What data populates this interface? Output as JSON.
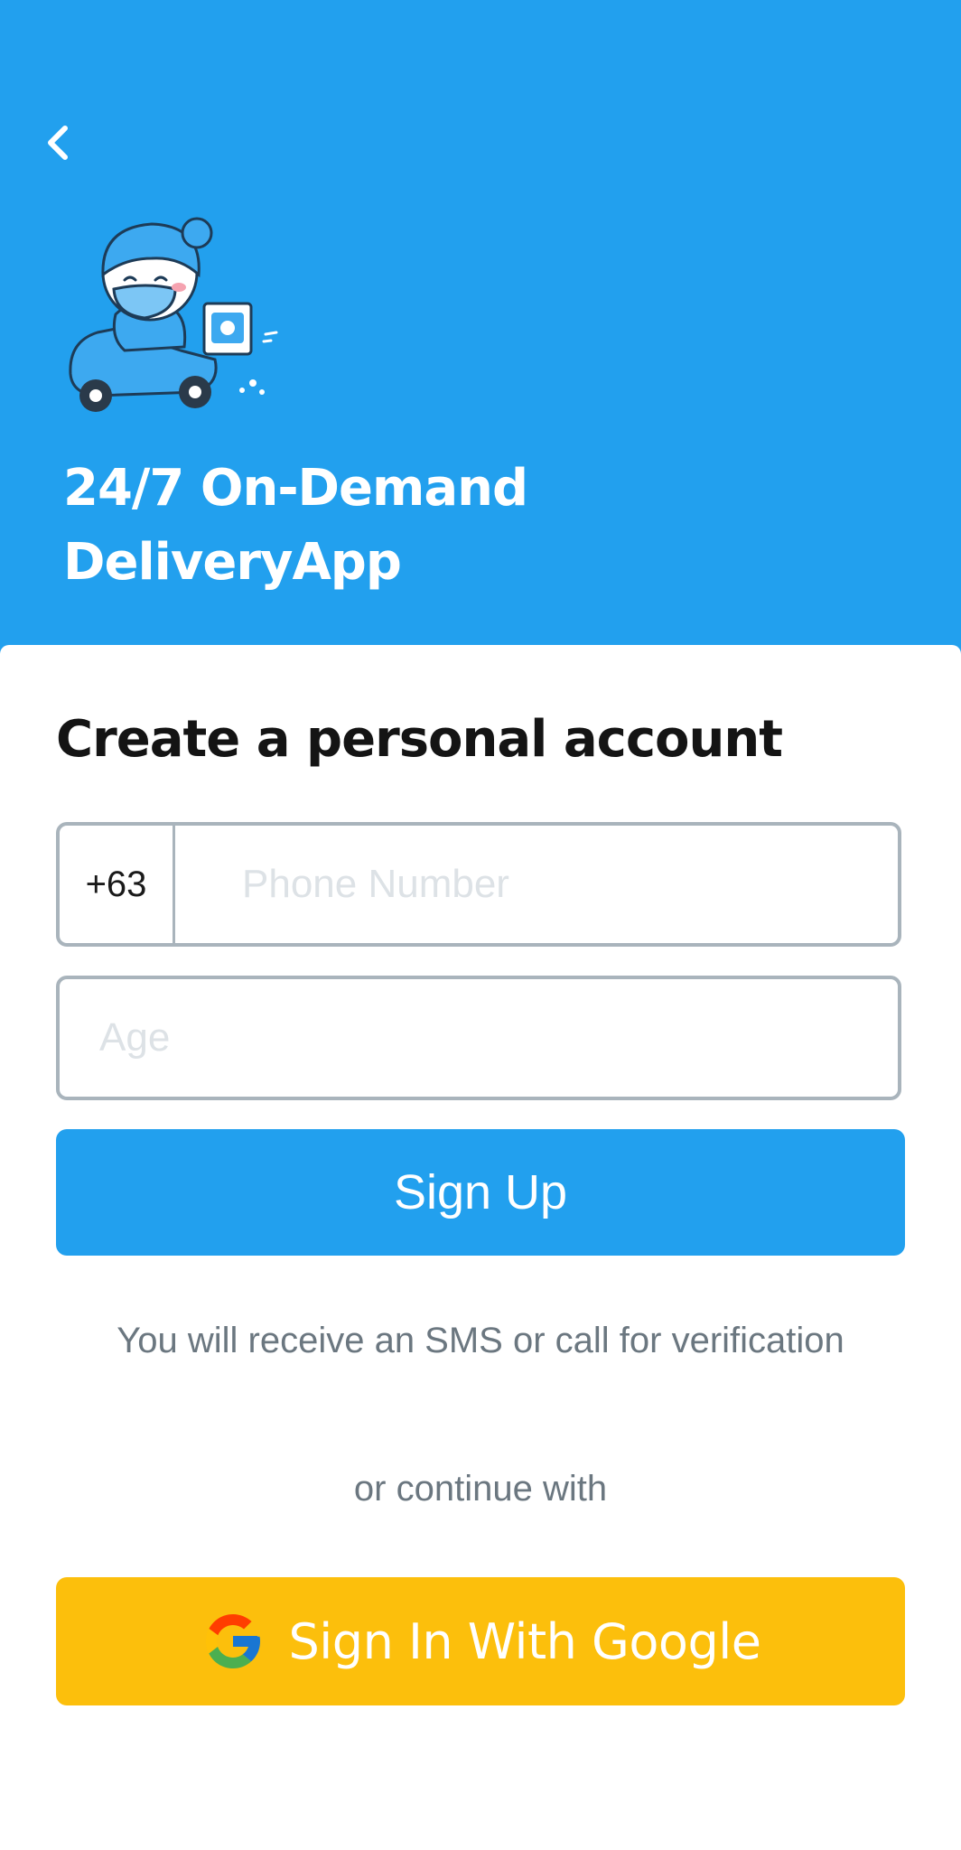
{
  "header": {
    "title_line1": "24/7 On-Demand",
    "title_line2": "DeliveryApp",
    "background_color": "#22a0ee",
    "back_icon": "chevron-left-icon",
    "mascot_icon": "delivery-scooter-mascot"
  },
  "form": {
    "title": "Create a personal account",
    "country_code": "+63",
    "phone_placeholder": "Phone Number",
    "phone_value": "",
    "age_placeholder": "Age",
    "age_value": "",
    "signup_label": "Sign Up",
    "sms_note": "You will receive an SMS or call for verification",
    "or_note": "or continue with",
    "google_label": "Sign In With Google",
    "google_icon": "google-g-icon",
    "accent_color": "#22a0ee",
    "google_button_color": "#fcbf0c"
  }
}
